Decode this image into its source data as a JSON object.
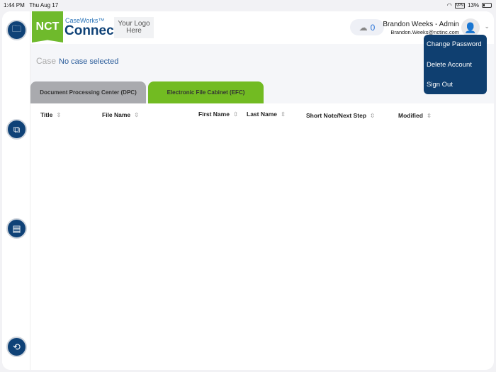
{
  "status": {
    "time": "1:44 PM",
    "date": "Thu Aug 17",
    "vpn": "VPN",
    "battery": "13%"
  },
  "header": {
    "logo_nct": "NCT",
    "logo_caseworks": "CaseWorks™",
    "logo_connect": "Connect",
    "your_logo": "Your Logo Here",
    "upload_count": "0",
    "user_name": "Brandon Weeks - Admin",
    "user_email": "Brandon.Weeks@nctinc.com"
  },
  "case": {
    "label": "Case",
    "value": "No case selected"
  },
  "tabs": [
    {
      "label": "Document Processing Center (DPC)"
    },
    {
      "label": "Electronic File Cabinet (EFC)"
    }
  ],
  "columns": [
    {
      "label": "Title"
    },
    {
      "label": "File Name"
    },
    {
      "label": "First Name"
    },
    {
      "label": "Last Name"
    },
    {
      "label": "Short Note/Next Step"
    },
    {
      "label": "Modified"
    }
  ],
  "menu": [
    {
      "label": "Change Password"
    },
    {
      "label": "Delete Account"
    },
    {
      "label": "Sign Out"
    }
  ],
  "colors": {
    "brand_blue": "#0f4277",
    "brand_green": "#72bb22"
  }
}
